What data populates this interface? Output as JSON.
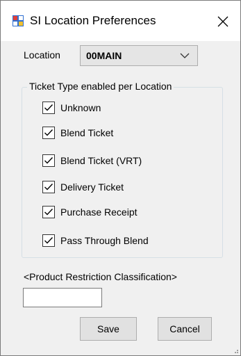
{
  "window": {
    "title": "SI Location Preferences",
    "icon": "app-grid-icon",
    "close_icon": "close-icon"
  },
  "location": {
    "label": "Location",
    "selected_value": "00MAIN"
  },
  "ticket_types": {
    "group_title": "Ticket Type enabled per Location",
    "items": [
      {
        "label": "Unknown",
        "checked": true
      },
      {
        "label": "Blend Ticket",
        "checked": true
      },
      {
        "label": "Blend Ticket (VRT)",
        "checked": true
      },
      {
        "label": "Delivery Ticket",
        "checked": true
      },
      {
        "label": "Purchase Receipt",
        "checked": true
      },
      {
        "label": "Pass Through Blend",
        "checked": true
      }
    ]
  },
  "restriction": {
    "label": "<Product Restriction Classification>",
    "value": ""
  },
  "buttons": {
    "save": "Save",
    "cancel": "Cancel"
  },
  "colors": {
    "window_bg": "#f0f0f0",
    "titlebar_bg": "#ffffff",
    "button_bg": "#e1e1e1",
    "icon_red": "#e0403a",
    "icon_blue": "#2f6fd1",
    "icon_yellow": "#f2c12e"
  }
}
